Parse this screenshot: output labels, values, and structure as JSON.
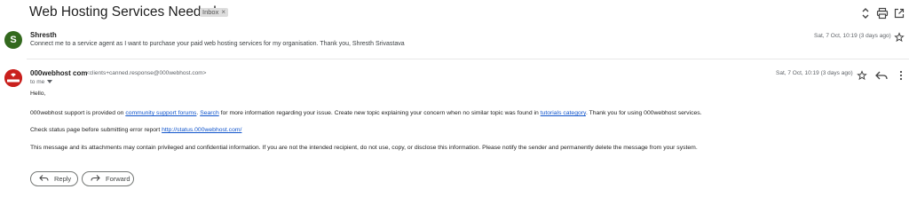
{
  "header": {
    "subject": "Web Hosting Services Needed",
    "label_chip": "Inbox",
    "label_chip_close": "×",
    "icons": [
      "unfold-icon",
      "print-icon",
      "open-new-window-icon"
    ]
  },
  "messages": [
    {
      "avatar_letter": "S",
      "avatar_color": "#33691e",
      "sender": "Shresth",
      "snippet": "Connect me to a service agent as I want to purchase your paid web hosting services for my organisation. Thank you, Shresth Srivastava",
      "date": "Sat, 7 Oct, 10:19 (3 days ago)"
    },
    {
      "avatar_color": "#c9201d",
      "avatar_logo_text": "000webhost",
      "sender": "000webhost com",
      "sender_email": "<clients+canned.response@000webhost.com>",
      "recipient": "to me",
      "date": "Sat, 7 Oct, 10:19 (3 days ago)",
      "body": {
        "greeting": "Hello,",
        "p1_a": "000webhost support is provided on ",
        "p1_link1": "community support forums",
        "p1_b": ". ",
        "p1_link2": "Search",
        "p1_c": " for more information regarding your issue. Create new topic explaining your concern when no similar topic was found in ",
        "p1_link3": "tutorials category",
        "p1_d": ". Thank you for using 000webhost services.",
        "p2_a": "Check status page before submitting error report ",
        "p2_link": "http://status.000webhost.com/",
        "p3": "This message and its attachments may contain privileged and confidential information. If you are not the intended recipient, do not use, copy, or disclose this information. Please notify the sender and permanently delete the message from your system."
      }
    }
  ],
  "actions": {
    "reply_label": "Reply",
    "forward_label": "Forward"
  },
  "colors": {
    "link": "#1155cc",
    "chip_bg": "#dddddd"
  }
}
